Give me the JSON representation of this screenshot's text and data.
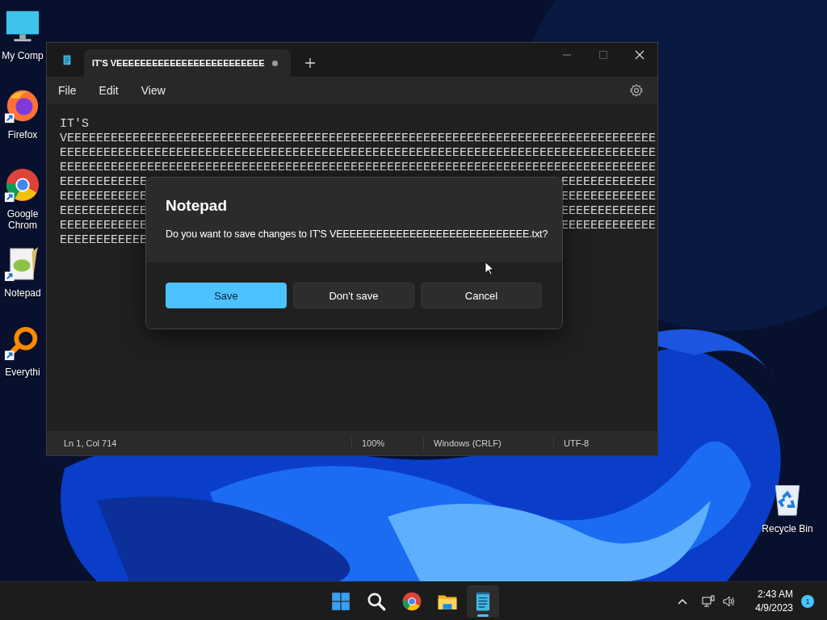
{
  "desktop_icons": [
    {
      "kind": "computer",
      "label": "My Comp"
    },
    {
      "kind": "firefox",
      "label": "Firefox"
    },
    {
      "kind": "chrome",
      "label": "Google Chrom"
    },
    {
      "kind": "notepadpp",
      "label": "Notepad"
    },
    {
      "kind": "everything",
      "label": "Everythi"
    }
  ],
  "recycle_bin": {
    "label": "Recycle Bin"
  },
  "window": {
    "tabs": [
      {
        "title": "IT'S VEEEEEEEEEEEEEEEEEEEEEEEEE",
        "selected": true,
        "modified": true
      }
    ],
    "menu": [
      "File",
      "Edit",
      "View"
    ],
    "editor": {
      "lines": [
        {
          "left": "IT'S"
        },
        {
          "left": "VEEEEEEEEEEEEEEEEEEEEEEEEEEEEEEEEEEEEEEEEEEEEEEEEEEEEEEEEEEEEEEEEEEEEEEEEEEEEEEEEE"
        },
        {
          "left": "EEEEEEEEEEEEEEEEEEEEEEEEEEEEEEEEEEEEEEEEEEEEEEEEEEEEEEEEEEEEEEEEEEEEEEEEEEEEEEEEEE"
        },
        {
          "left": "EEEEEEEEEEEEEEEEEEEEEEEEEEEEEEEEEEEEEEEEEEEEEEEEEEEEEEEEEEEEEEEEEEEEEEEEEEEEEEEEEE"
        },
        {
          "left": "EEEEEEEEEEEE",
          "right": "EEEEEEEEEEEEE"
        },
        {
          "left": "EEEEEEEEEEEE",
          "right": "EEEEEEEEEEEEE"
        },
        {
          "left": "EEEEEEEEEEEE",
          "right": "EEEEEEEEEEEEE"
        },
        {
          "left": "EEEEEEEEEEEE",
          "right": "EEEEEEEEEEEEE"
        },
        {
          "left": "EEEEEEEEEEEE"
        }
      ]
    },
    "status_bar": [
      "Ln 1, Col 714",
      "100%",
      "Windows (CRLF)",
      "UTF-8"
    ]
  },
  "dialog": {
    "title": "Notepad",
    "message": "Do you want to save changes to IT'S VEEEEEEEEEEEEEEEEEEEEEEEEEEEEE.txt?",
    "buttons": [
      {
        "label": "Save",
        "primary": true
      },
      {
        "label": "Don't save",
        "primary": false
      },
      {
        "label": "Cancel",
        "primary": false
      }
    ]
  },
  "taskbar": {
    "apps": [
      {
        "kind": "start",
        "active": false
      },
      {
        "kind": "search",
        "active": false
      },
      {
        "kind": "chrome",
        "active": false
      },
      {
        "kind": "folder",
        "active": false
      },
      {
        "kind": "notepad",
        "active": true
      }
    ],
    "time": "2:43 AM",
    "date": "4/9/2023",
    "notification_count": "1"
  }
}
